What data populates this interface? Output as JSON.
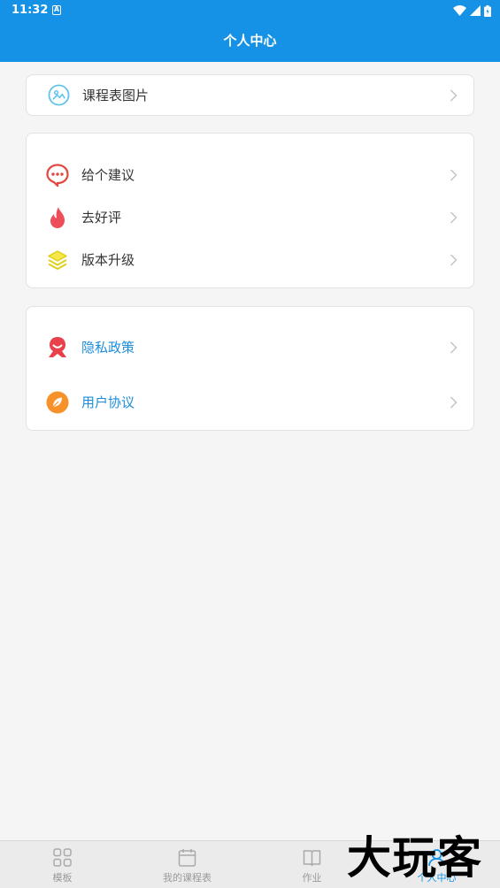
{
  "status_bar": {
    "time": "11:32",
    "notification_icon": "A"
  },
  "header": {
    "title": "个人中心"
  },
  "cards": [
    {
      "items": [
        {
          "label": "课程表图片",
          "icon": "image-icon"
        }
      ]
    },
    {
      "items": [
        {
          "label": "给个建议",
          "icon": "chat-bubble-icon"
        },
        {
          "label": "去好评",
          "icon": "flame-icon"
        },
        {
          "label": "版本升级",
          "icon": "layers-icon"
        }
      ]
    },
    {
      "items": [
        {
          "label": "隐私政策",
          "icon": "shield-icon"
        },
        {
          "label": "用户协议",
          "icon": "leaf-icon"
        }
      ]
    }
  ],
  "tabbar": {
    "tabs": [
      {
        "label": "模板",
        "icon": "grid-icon"
      },
      {
        "label": "我的课程表",
        "icon": "calendar-icon"
      },
      {
        "label": "作业",
        "icon": "book-icon"
      },
      {
        "label": "个人中心",
        "icon": "person-icon",
        "active": true
      }
    ]
  },
  "watermark": "大玩客",
  "colors": {
    "primary": "#1592e6",
    "link_text": "#1c8ddc",
    "background": "#f5f5f5"
  }
}
